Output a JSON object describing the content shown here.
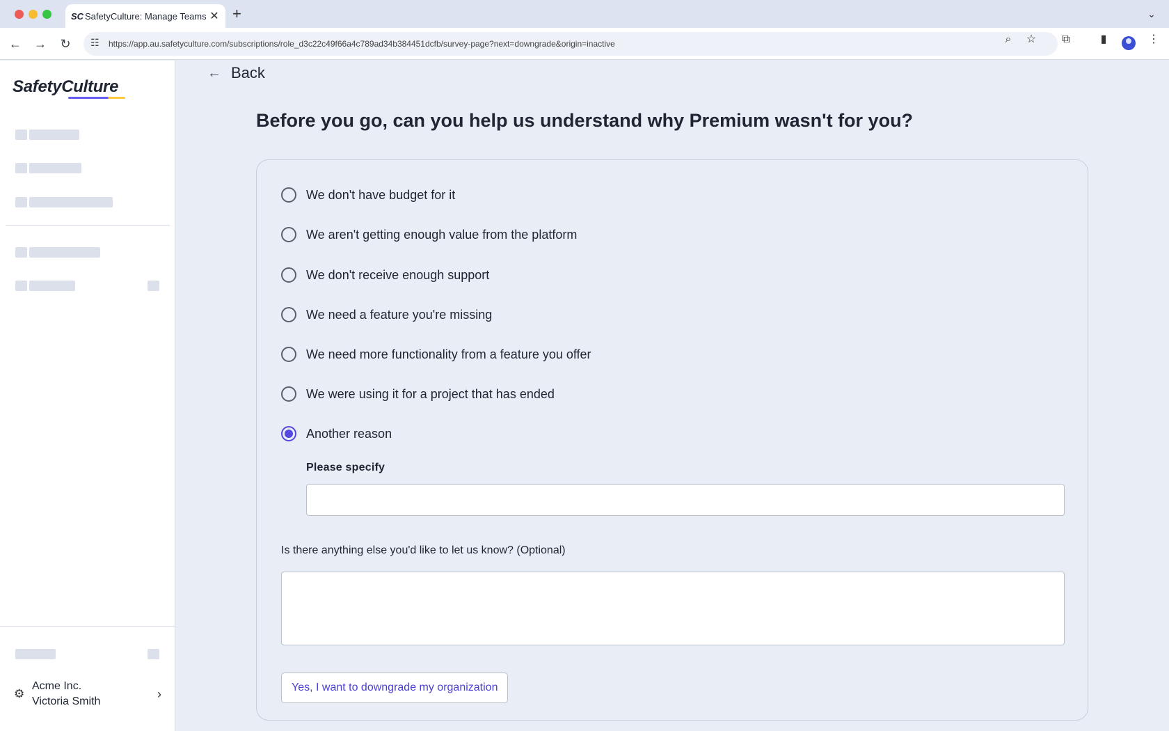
{
  "browser": {
    "tab_title": "SafetyCulture: Manage Teams and...",
    "tab_favicon": "SC",
    "tab_close_icon": "close-icon",
    "new_tab_symbol": "+",
    "url": "https://app.au.safetyculture.com/subscriptions/role_d3c22c49f66a4c789ad34b384451dcfb/survey-page?next=downgrade&origin=inactive"
  },
  "sidebar": {
    "logo_text": "SafetyCulture",
    "org_name": "Acme Inc.",
    "user_name": "Victoria Smith"
  },
  "main": {
    "back_label": "Back",
    "heading": "Before you go, can you help us understand why Premium wasn't for you?",
    "options": [
      {
        "label": "We don't have budget for it",
        "selected": false
      },
      {
        "label": "We aren't getting enough value from the platform",
        "selected": false
      },
      {
        "label": "We don't receive enough support",
        "selected": false
      },
      {
        "label": "We need a feature you're missing",
        "selected": false
      },
      {
        "label": "We need more functionality from a feature you offer",
        "selected": false
      },
      {
        "label": "We were using it for a project that has ended",
        "selected": false
      },
      {
        "label": "Another reason",
        "selected": true
      }
    ],
    "specify_label": "Please specify",
    "specify_value": "",
    "optional_label": "Is there anything else you'd like to let us know? (Optional)",
    "optional_value": "",
    "downgrade_button": "Yes, I want to downgrade my organization"
  },
  "colors": {
    "accent": "#5548e0",
    "page_bg": "#e9edf6",
    "sidebar_bg": "#ffffff",
    "skeleton": "#dbe0ea"
  }
}
